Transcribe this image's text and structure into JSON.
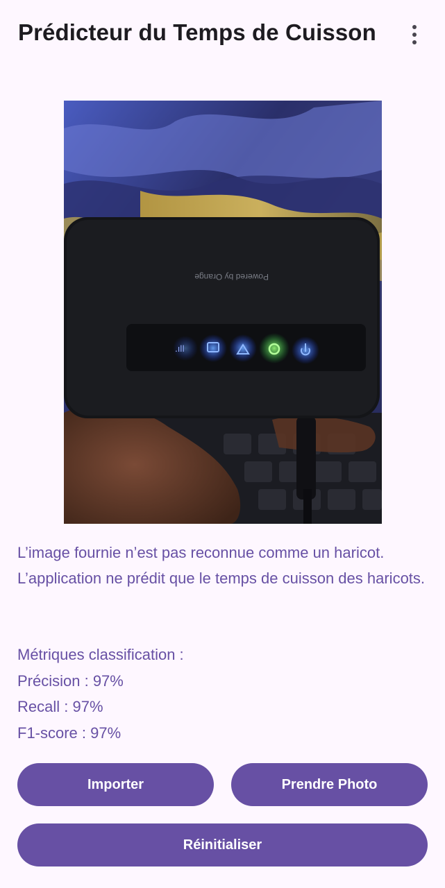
{
  "app_bar": {
    "title": "Prédicteur du Temps de Cuisson",
    "menu_icon": "more-vert-icon"
  },
  "photo": {
    "device_text": "Powered by Orange"
  },
  "result": {
    "message": "L’image fournie n’est pas reconnue comme un haricot. L’application ne prédit que le temps de cuisson des haricots."
  },
  "metrics": {
    "heading": "Métriques classification :",
    "precision": "Précision : 97%",
    "recall": "Recall : 97%",
    "f1": "F1-score : 97%"
  },
  "buttons": {
    "import_label": "Importer",
    "take_photo_label": "Prendre Photo",
    "reset_label": "Réinitialiser"
  },
  "colors": {
    "background": "#FEF7FF",
    "primary": "#6750A4",
    "on_primary": "#FFFFFF",
    "title": "#1D1B20"
  }
}
